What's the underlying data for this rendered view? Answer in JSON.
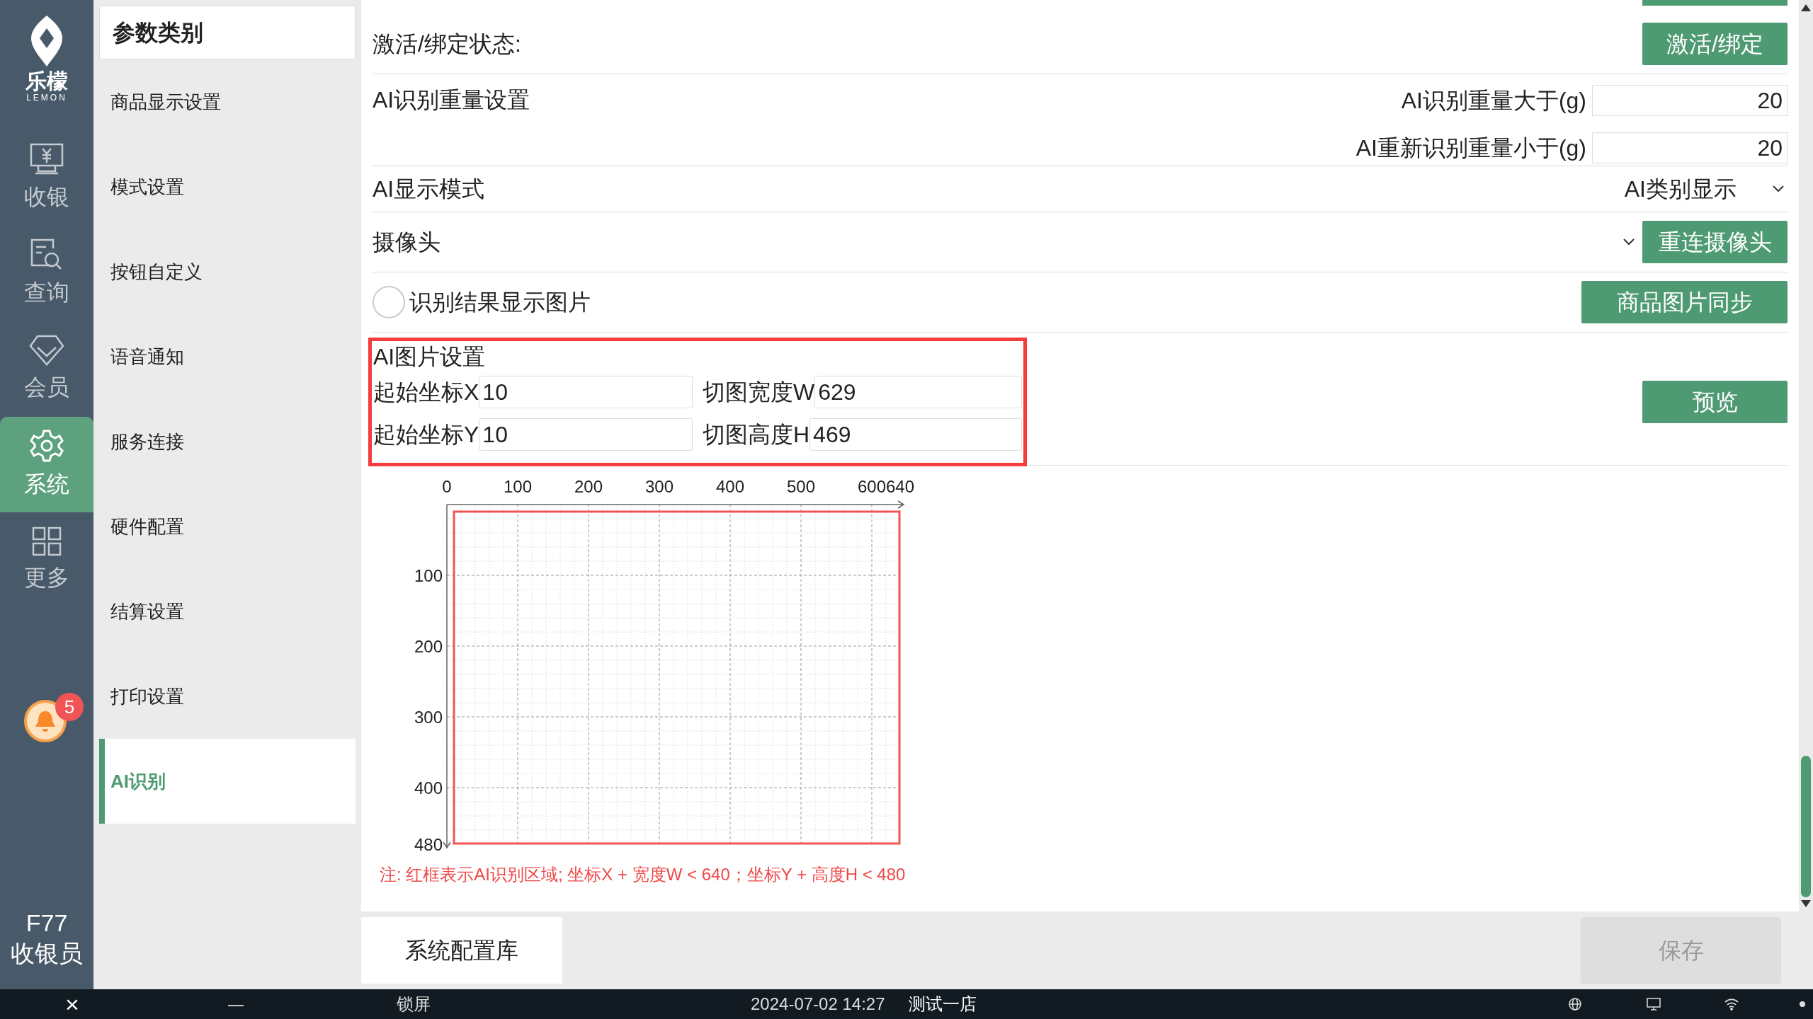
{
  "nav": {
    "logo_text": "乐檬",
    "logo_sub": "LEMON",
    "items": [
      {
        "label": "收银",
        "selected": false
      },
      {
        "label": "查询",
        "selected": false
      },
      {
        "label": "会员",
        "selected": false
      },
      {
        "label": "系统",
        "selected": true
      },
      {
        "label": "更多",
        "selected": false
      }
    ],
    "notification_count": "5",
    "user_code": "F77",
    "user_role": "收银员"
  },
  "categories": {
    "title": "参数类别",
    "items": [
      {
        "label": "商品显示设置",
        "selected": false
      },
      {
        "label": "模式设置",
        "selected": false
      },
      {
        "label": "按钮自定义",
        "selected": false
      },
      {
        "label": "语音通知",
        "selected": false
      },
      {
        "label": "服务连接",
        "selected": false
      },
      {
        "label": "硬件配置",
        "selected": false
      },
      {
        "label": "结算设置",
        "selected": false
      },
      {
        "label": "打印设置",
        "selected": false
      },
      {
        "label": "AI识别",
        "selected": true
      }
    ]
  },
  "settings": {
    "activation": {
      "label": "激活/绑定状态:",
      "button": "激活/绑定"
    },
    "weight": {
      "label": "AI识别重量设置",
      "fields": [
        {
          "label": "AI识别重量大于(g)",
          "value": "20"
        },
        {
          "label": "AI重新识别重量小于(g)",
          "value": "20"
        }
      ]
    },
    "display_mode": {
      "label": "AI显示模式",
      "value": "AI类别显示"
    },
    "camera": {
      "label": "摄像头",
      "button": "重连摄像头"
    },
    "show_image": {
      "label": "识别结果显示图片",
      "checked": false,
      "button": "商品图片同步"
    },
    "image_settings": {
      "title": "AI图片设置",
      "fields": [
        {
          "label": "起始坐标X",
          "value": "10"
        },
        {
          "label": "切图宽度W",
          "value": "629"
        },
        {
          "label": "起始坐标Y",
          "value": "10"
        },
        {
          "label": "切图高度H",
          "value": "469"
        }
      ],
      "button": "预览"
    },
    "preview": {
      "x_ticks": [
        "0",
        "100",
        "200",
        "300",
        "400",
        "500",
        "600",
        "640"
      ],
      "y_ticks": [
        "100",
        "200",
        "300",
        "400",
        "480"
      ]
    },
    "note": "注: 红框表示AI识别区域; 坐标X + 宽度W < 640；坐标Y + 高度H < 480"
  },
  "footer": {
    "config_button": "系统配置库",
    "save_button": "保存",
    "save_disabled": true
  },
  "taskbar": {
    "close": "×",
    "minimize": "—",
    "lock": "锁屏",
    "datetime": "2024-07-02 14:27",
    "store": "测试一店"
  }
}
